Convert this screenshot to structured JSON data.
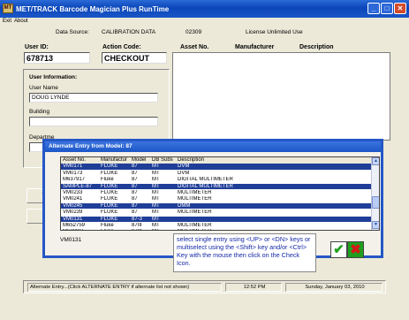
{
  "window": {
    "title": "MET/TRACK Barcode Magician Plus RunTime",
    "icon_glyph": "MT",
    "min_glyph": "_",
    "max_glyph": "□",
    "close_glyph": "✕"
  },
  "menu": {
    "items": [
      "Exit",
      "About"
    ]
  },
  "header": {
    "data_source_label": "Data Source:",
    "data_source_value": "CALIBRATION DATA",
    "code": "02309",
    "license": "License Unlimited Use"
  },
  "form": {
    "user_id_label": "User ID:",
    "user_id_value": "678713",
    "action_code_label": "Action Code:",
    "action_code_value": "CHECKOUT",
    "user_info_heading": "User Information:",
    "user_name_label": "User Name",
    "user_name_value": "DOUG LYNDE",
    "building_label": "Building",
    "department_label": "Departme",
    "side_button_1_label": "V",
    "side_button_2_label": ""
  },
  "results_table": {
    "columns": [
      "Asset No.",
      "Manufacturer",
      "Description"
    ]
  },
  "dialog": {
    "title": "Alternate Entry from Model: 87",
    "columns": [
      "Asset No.",
      "Manufacturer",
      "Model",
      "DB Subset",
      "Description"
    ],
    "rows": [
      {
        "asset": "VM0171",
        "mfr": "FLUKE",
        "model": "87",
        "subset": "MT",
        "desc": "DVM",
        "selected": true
      },
      {
        "asset": "VM0173",
        "mfr": "FLUKE",
        "model": "87",
        "subset": "MT",
        "desc": "DVM",
        "selected": false
      },
      {
        "asset": "M637917",
        "mfr": "Fluke",
        "model": "87",
        "subset": "MT",
        "desc": "DIGITAL MULTIMETER",
        "selected": false
      },
      {
        "asset": "SAMPLE-87",
        "mfr": "FLUKE",
        "model": "87",
        "subset": "MT",
        "desc": "DIGITAL MULTIMETER",
        "selected": true
      },
      {
        "asset": "VM0233",
        "mfr": "FLUKE",
        "model": "87",
        "subset": "MT",
        "desc": "MULTIMETER",
        "selected": false
      },
      {
        "asset": "VM0241",
        "mfr": "FLUKE",
        "model": "87",
        "subset": "MT",
        "desc": "MULTIMETER",
        "selected": false
      },
      {
        "asset": "VM0245",
        "mfr": "FLUKE",
        "model": "87",
        "subset": "MT",
        "desc": "DMM",
        "selected": true
      },
      {
        "asset": "VM0239",
        "mfr": "FLUKE",
        "model": "87",
        "subset": "MT",
        "desc": "MULTIMETER",
        "selected": false
      },
      {
        "asset": "VM0131",
        "mfr": "FLUKE",
        "model": "87-3",
        "subset": "MT",
        "desc": "",
        "selected": true
      },
      {
        "asset": "M652759",
        "mfr": "Fluke",
        "model": "87III",
        "subset": "MT",
        "desc": "MULTIMETER",
        "selected": false
      },
      {
        "asset": "M630865",
        "mfr": "Fluke",
        "model": "87III",
        "subset": "MT",
        "desc": "MULTIMETER",
        "selected": false
      }
    ],
    "scroll_up_glyph": "▲",
    "scroll_down_glyph": "▼",
    "current_asset": "VM0131",
    "instructions": "select single entry using <UP> or <DN> keys or multiselect using the <Shift> key and/or <Ctrl> Key with the mouse then click on the Check Icon.",
    "ok_glyph": "✔",
    "cancel_glyph": "✖"
  },
  "status": {
    "message": "Alternate Entry...(Click ALTERNATE ENTRY if alternate list not shown)",
    "time": "12:52 PM",
    "date": "Sunday, January 03, 2010"
  },
  "colors": {
    "selected_row": "#1f3e98",
    "titlebar": "#0b46b8",
    "instruction_text": "#1428a8",
    "ok_check": "#1ea01e",
    "cancel_x": "#d61818"
  }
}
